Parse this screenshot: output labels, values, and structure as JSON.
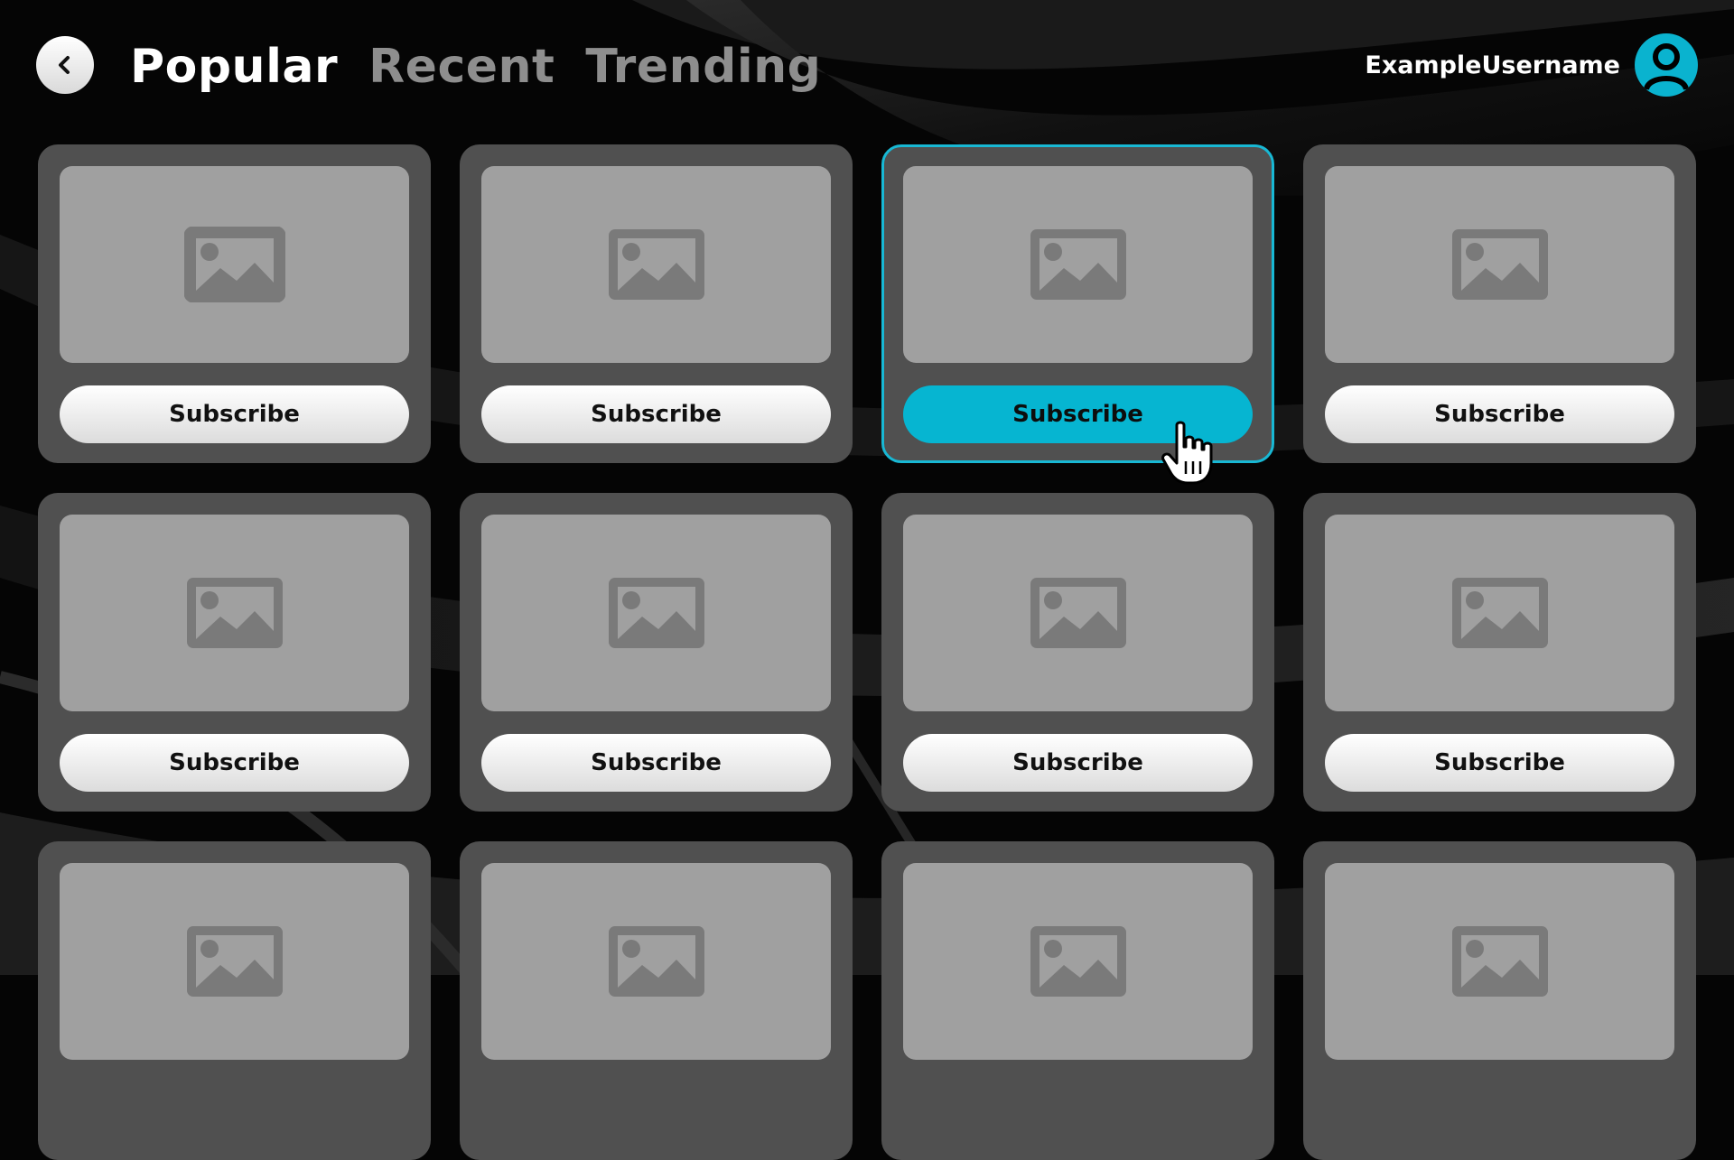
{
  "header": {
    "back_icon": "chevron-left-icon",
    "tabs": [
      {
        "label": "Popular",
        "active": true
      },
      {
        "label": "Recent",
        "active": false
      },
      {
        "label": "Trending",
        "active": false
      }
    ],
    "username": "ExampleUsername",
    "avatar_icon": "user-icon"
  },
  "grid": {
    "thumbnail_icon": "image-placeholder-icon",
    "highlighted_card": 3,
    "cards": [
      {
        "button_label": "Subscribe"
      },
      {
        "button_label": "Subscribe"
      },
      {
        "button_label": "Subscribe"
      },
      {
        "button_label": "Subscribe"
      },
      {
        "button_label": "Subscribe"
      },
      {
        "button_label": "Subscribe"
      },
      {
        "button_label": "Subscribe"
      },
      {
        "button_label": "Subscribe"
      }
    ]
  },
  "colors": {
    "accent": "#06b5d1",
    "card": "#505050",
    "thumbnail": "#a0a0a0",
    "background": "#050505"
  }
}
